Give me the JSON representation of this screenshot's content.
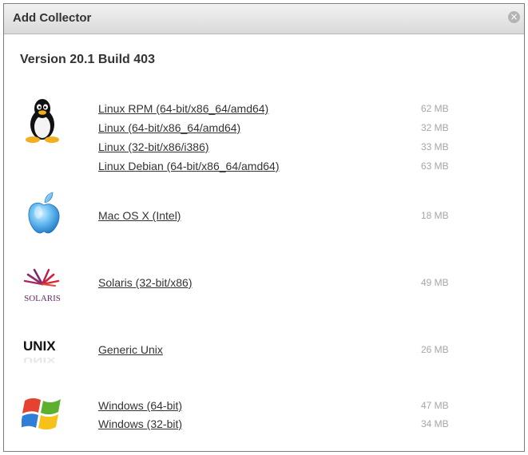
{
  "dialog": {
    "title": "Add Collector",
    "close_symbol": "×",
    "version": "Version 20.1 Build 403"
  },
  "groups": [
    {
      "os": "linux",
      "icon": "tux-penguin-icon",
      "downloads": [
        {
          "label": "Linux RPM (64-bit/x86_64/amd64)",
          "size": "62 MB"
        },
        {
          "label": "Linux (64-bit/x86_64/amd64)",
          "size": "32 MB"
        },
        {
          "label": "Linux (32-bit/x86/i386)",
          "size": "33 MB"
        },
        {
          "label": "Linux Debian (64-bit/x86_64/amd64)",
          "size": "63 MB"
        }
      ]
    },
    {
      "os": "mac",
      "icon": "apple-icon",
      "downloads": [
        {
          "label": "Mac OS X (Intel)",
          "size": "18 MB"
        }
      ]
    },
    {
      "os": "solaris",
      "icon": "solaris-logo-icon",
      "logo_text": "SOLARIS",
      "downloads": [
        {
          "label": "Solaris (32-bit/x86)",
          "size": "49 MB"
        }
      ]
    },
    {
      "os": "unix",
      "icon": "unix-logo-icon",
      "logo_text": "UNIX",
      "downloads": [
        {
          "label": "Generic Unix",
          "size": "26 MB"
        }
      ]
    },
    {
      "os": "windows",
      "icon": "windows-logo-icon",
      "downloads": [
        {
          "label": "Windows (64-bit)",
          "size": "47 MB"
        },
        {
          "label": "Windows (32-bit)",
          "size": "34 MB"
        }
      ]
    }
  ]
}
